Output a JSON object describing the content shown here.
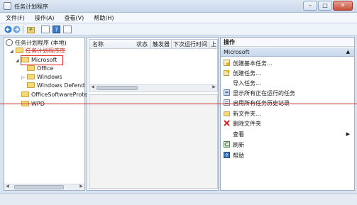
{
  "window": {
    "title": "任务计划程序"
  },
  "menu": [
    "文件(F)",
    "操作(A)",
    "查看(V)",
    "帮助(H)"
  ],
  "tree": {
    "root": "任务计划程序 (本地)",
    "library": "任务计划程序库",
    "items": [
      {
        "label": "Microsoft",
        "selected": true
      },
      {
        "label": "Office"
      },
      {
        "label": "Windows"
      },
      {
        "label": "Windows Defend"
      },
      {
        "label": "OfficeSoftwareProte"
      },
      {
        "label": "WPD"
      }
    ]
  },
  "columns": [
    "名称",
    "状态",
    "触发器",
    "下次运行时间",
    "上"
  ],
  "actions": {
    "header": "操作",
    "section": "Microsoft",
    "items": [
      {
        "label": "创建基本任务...",
        "icon": "create-basic-task-icon"
      },
      {
        "label": "创建任务...",
        "icon": "create-task-icon"
      },
      {
        "label": "导入任务...",
        "icon": ""
      },
      {
        "label": "显示所有正在运行的任务",
        "icon": "running-tasks-icon"
      },
      {
        "label": "启用所有任务历史记录",
        "icon": "history-icon"
      },
      {
        "label": "新文件夹...",
        "icon": "folder-icon"
      },
      {
        "label": "删除文件夹",
        "icon": "delete-icon"
      },
      {
        "label": "查看",
        "icon": ""
      },
      {
        "label": "刷新",
        "icon": "refresh-icon"
      },
      {
        "label": "帮助",
        "icon": "help-icon"
      }
    ]
  },
  "colors": {
    "selection_box": "#e0262c",
    "accent": "#1c64b4"
  }
}
